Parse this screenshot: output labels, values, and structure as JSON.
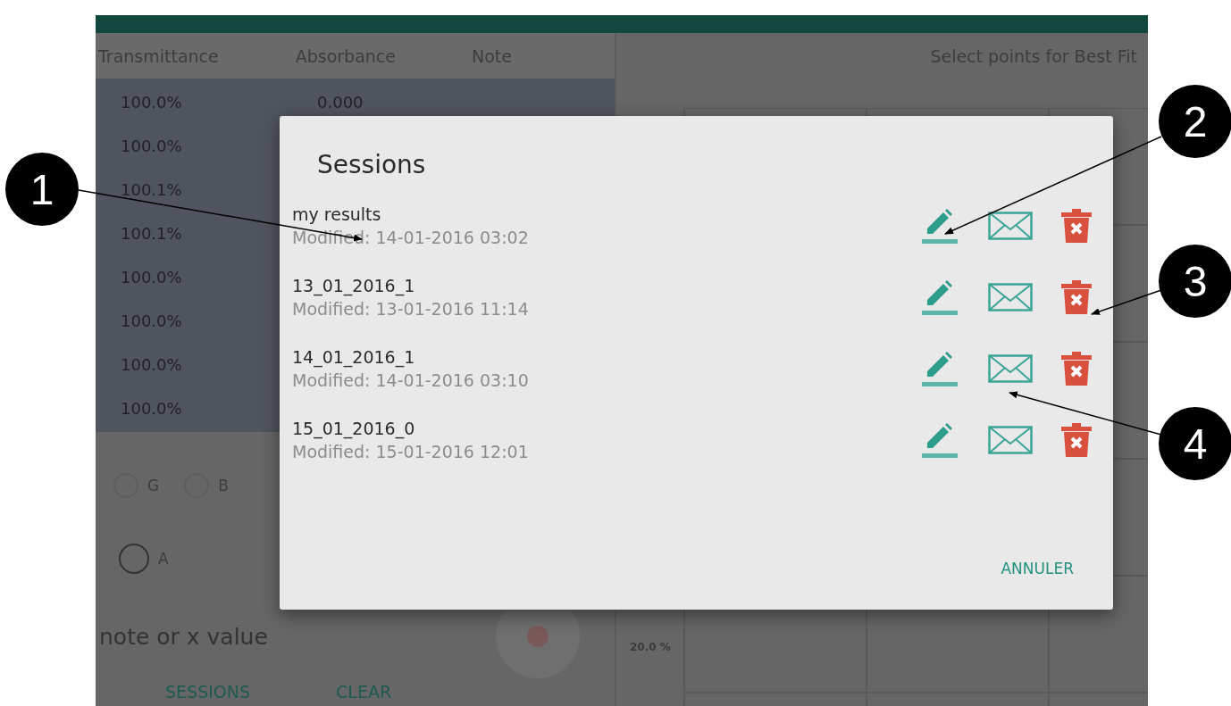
{
  "table": {
    "columns": [
      "Transmittance",
      "Absorbance",
      "Note"
    ],
    "rows": [
      {
        "transmittance": "100.0%",
        "absorbance": "0.000"
      },
      {
        "transmittance": "100.0%"
      },
      {
        "transmittance": "100.1%"
      },
      {
        "transmittance": "100.1%"
      },
      {
        "transmittance": "100.0%"
      },
      {
        "transmittance": "100.0%"
      },
      {
        "transmittance": "100.0%"
      },
      {
        "transmittance": "100.0%"
      }
    ]
  },
  "color_options": [
    {
      "label": "G",
      "selected": false
    },
    {
      "label": "B",
      "selected": false
    }
  ],
  "mode_option": {
    "label": "A",
    "selected": false
  },
  "note_field": {
    "placeholder": "note or x value"
  },
  "buttons": [
    "SESSIONS",
    "CLEAR"
  ],
  "chart": {
    "title": "Select points for Best Fit",
    "y_tick": "20.0 %"
  },
  "dialog": {
    "title": "Sessions",
    "sessions": [
      {
        "name": "my results",
        "modified": "Modified: 14-01-2016 03:02"
      },
      {
        "name": "13_01_2016_1",
        "modified": "Modified: 13-01-2016 11:14"
      },
      {
        "name": "14_01_2016_1",
        "modified": "Modified: 14-01-2016 03:10"
      },
      {
        "name": "15_01_2016_0",
        "modified": "Modified: 15-01-2016 12:01"
      }
    ],
    "cancel": "ANNULER"
  },
  "callouts": [
    "1",
    "2",
    "3",
    "4"
  ]
}
